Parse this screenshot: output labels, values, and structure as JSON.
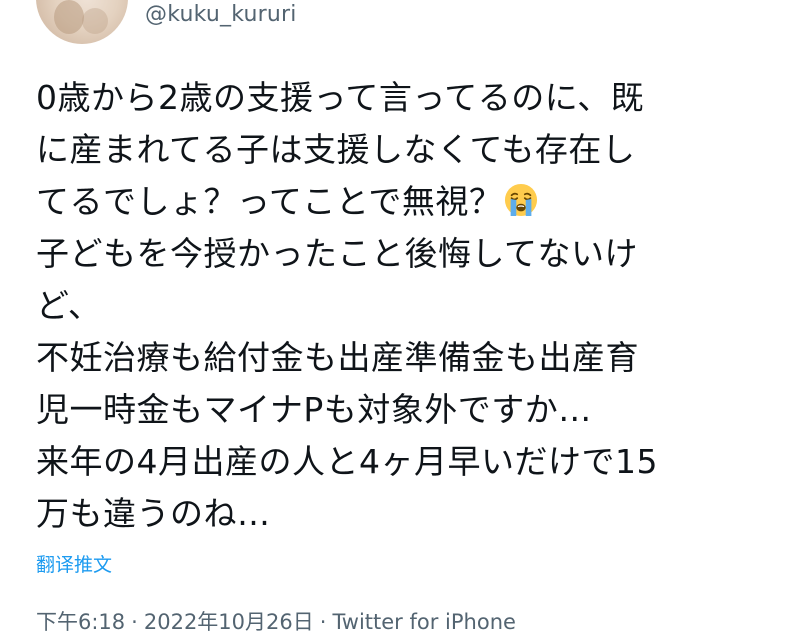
{
  "author": {
    "handle": "@kuku_kururi"
  },
  "tweet": {
    "lines": [
      "0歳から2歳の支援って言ってるのに、既",
      "に産まれてる子は支援しなくても存在し",
      "てるでしょ？ってことで無視？",
      "子どもを今授かったこと後悔してないけ",
      "ど、",
      "不妊治療も給付金も出産準備金も出産育",
      "児一時金もマイナPも対象外ですか…",
      "来年の4月出産の人と4ヶ月早いだけで15",
      "万も違うのね…"
    ],
    "emoji": "crying-face-emoji"
  },
  "translate_label": "翻译推文",
  "meta": {
    "time": "下午6:18",
    "separator": "·",
    "date": "2022年10月26日",
    "source": "Twitter for iPhone"
  },
  "colors": {
    "text": "#0f1419",
    "secondary": "#536471",
    "link": "#1d9bf0"
  }
}
